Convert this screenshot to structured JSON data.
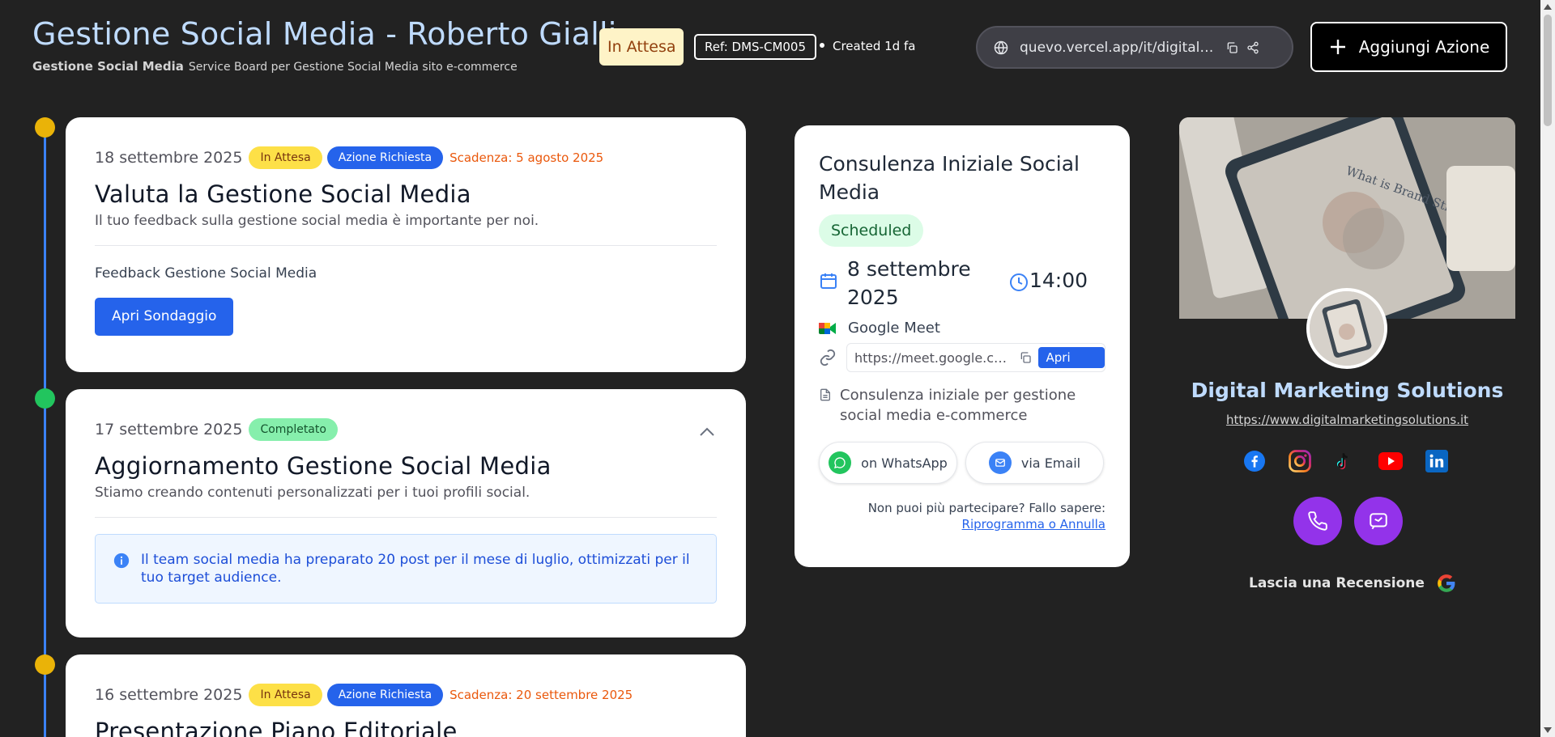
{
  "header": {
    "title": "Gestione Social Media - Roberto Gialli",
    "subtitle_strong": "Gestione Social Media",
    "subtitle_desc": "Service Board per Gestione Social Media sito e-commerce",
    "status": "In Attesa",
    "ref": "Ref: DMS-CM005",
    "created": "Created 1d fa",
    "url": "quevo.vercel.app/it/digital_marketing",
    "add_action_label": "Aggiungi Azione"
  },
  "timeline": [
    {
      "date": "18 settembre 2025",
      "status": "In Attesa",
      "action": "Azione Richiesta",
      "deadline": "Scadenza: 5 agosto 2025",
      "title": "Valuta la Gestione Social Media",
      "description": "Il tuo feedback sulla gestione social media è importante per noi.",
      "label": "Feedback Gestione Social Media",
      "button": "Apri Sondaggio"
    },
    {
      "date": "17 settembre 2025",
      "status": "Completato",
      "title": "Aggiornamento Gestione Social Media",
      "description": "Stiamo creando contenuti personalizzati per i tuoi profili social.",
      "info": "Il team social media ha preparato 20 post per il mese di luglio, ottimizzati per il tuo target audience."
    },
    {
      "date": "16 settembre 2025",
      "status": "In Attesa",
      "action": "Azione Richiesta",
      "deadline": "Scadenza: 20 settembre 2025",
      "title": "Presentazione Piano Editoriale"
    }
  ],
  "meeting": {
    "title": "Consulenza Iniziale Social Media",
    "status": "Scheduled",
    "date": "8 settembre 2025",
    "time": "14:00",
    "platform": "Google Meet",
    "link": "https://meet.google.com/abc-defg-hij",
    "open_link": "Apri Link",
    "notes": "Consulenza iniziale per gestione social media e-commerce",
    "whatsapp": "on WhatsApp",
    "email": "via Email",
    "footer_text": "Non puoi più partecipare? Fallo sapere:",
    "footer_link": "Riprogramma o Annulla"
  },
  "business": {
    "name": "Digital Marketing Solutions",
    "url": "https://www.digitalmarketingsolutions.it",
    "image_text": "What is Brand Strategy?",
    "review": "Lascia una Recensione",
    "social": [
      "facebook-icon",
      "instagram-icon",
      "tiktok-icon",
      "youtube-icon",
      "linkedin-icon"
    ]
  },
  "colors": {
    "background": "#222222",
    "accent_blue": "#2563eb",
    "purple": "#9333ea",
    "title_blue": "#bfdbfe"
  }
}
